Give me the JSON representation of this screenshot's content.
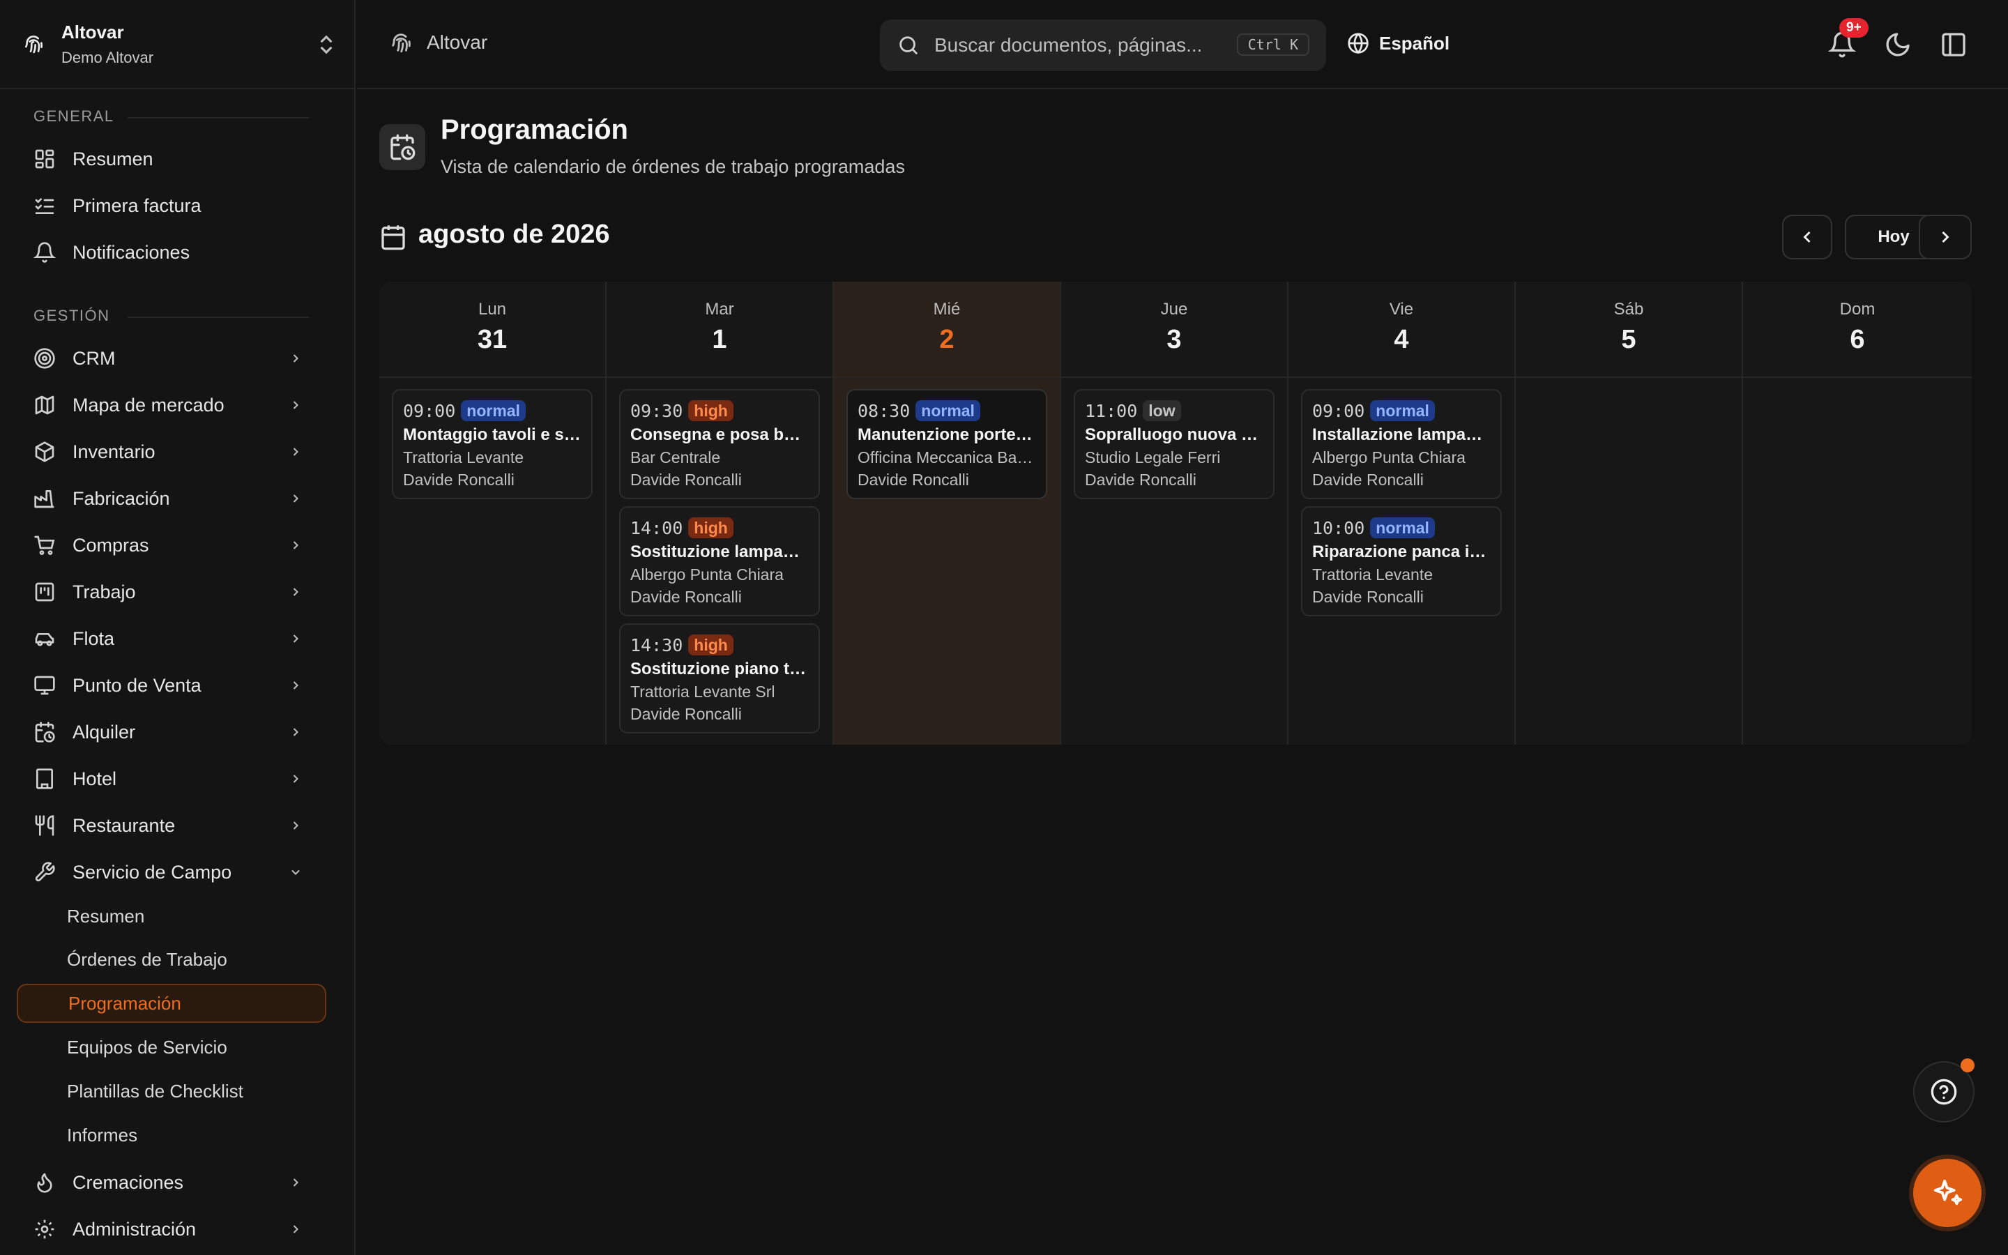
{
  "team": {
    "name": "Altovar",
    "subtitle": "Demo Altovar"
  },
  "sidebar": {
    "group_general": "GENERAL",
    "group_gestion": "GESTIÓN",
    "general": [
      {
        "label": "Resumen",
        "icon": "dashboard-icon"
      },
      {
        "label": "Primera factura",
        "icon": "checklist-icon"
      },
      {
        "label": "Notificaciones",
        "icon": "bell-icon"
      }
    ],
    "gestion": [
      {
        "label": "CRM",
        "icon": "target-icon"
      },
      {
        "label": "Mapa de mercado",
        "icon": "map-icon"
      },
      {
        "label": "Inventario",
        "icon": "box-icon"
      },
      {
        "label": "Fabricación",
        "icon": "factory-icon"
      },
      {
        "label": "Compras",
        "icon": "cart-icon"
      },
      {
        "label": "Trabajo",
        "icon": "kanban-icon"
      },
      {
        "label": "Flota",
        "icon": "car-icon"
      },
      {
        "label": "Punto de Venta",
        "icon": "monitor-icon"
      },
      {
        "label": "Alquiler",
        "icon": "calendar-clock-icon"
      },
      {
        "label": "Hotel",
        "icon": "building-icon"
      },
      {
        "label": "Restaurante",
        "icon": "utensils-icon"
      },
      {
        "label": "Servicio de Campo",
        "icon": "wrench-icon"
      }
    ],
    "field_service_sub": [
      {
        "label": "Resumen"
      },
      {
        "label": "Órdenes de Trabajo"
      },
      {
        "label": "Programación",
        "active": true
      },
      {
        "label": "Equipos de Servicio"
      },
      {
        "label": "Plantillas de Checklist"
      },
      {
        "label": "Informes"
      }
    ],
    "bottom": [
      {
        "label": "Cremaciones",
        "icon": "flame-icon"
      },
      {
        "label": "Administración",
        "icon": "gear-icon"
      }
    ]
  },
  "topbar": {
    "breadcrumb": "Altovar",
    "search_placeholder": "Buscar documentos, páginas...",
    "shortcut": "Ctrl K",
    "language": "Español",
    "notification_count": "9+"
  },
  "page": {
    "title": "Programación",
    "subtitle": "Vista de calendario de órdenes de trabajo programadas",
    "month_label": "agosto de 2026",
    "today_button": "Hoy"
  },
  "calendar": {
    "days": [
      {
        "dow": "Lun",
        "num": "31",
        "events": [
          {
            "time": "09:00",
            "priority": "normal",
            "title": "Montaggio tavoli e sedie",
            "client": "Trattoria Levante",
            "tech": "Davide Roncalli"
          }
        ]
      },
      {
        "dow": "Mar",
        "num": "1",
        "events": [
          {
            "time": "09:30",
            "priority": "high",
            "title": "Consegna e posa banco",
            "client": "Bar Centrale",
            "tech": "Davide Roncalli"
          },
          {
            "time": "14:00",
            "priority": "high",
            "title": "Sostituzione lampade sala",
            "client": "Albergo Punta Chiara",
            "tech": "Davide Roncalli"
          },
          {
            "time": "14:30",
            "priority": "high",
            "title": "Sostituzione piano tavolo",
            "client": "Trattoria Levante Srl",
            "tech": "Davide Roncalli"
          }
        ]
      },
      {
        "dow": "Mié",
        "num": "2",
        "today": true,
        "events": [
          {
            "time": "08:30",
            "priority": "normal",
            "title": "Manutenzione porte sezionali",
            "client": "Officina Meccanica Baldini",
            "tech": "Davide Roncalli"
          }
        ]
      },
      {
        "dow": "Jue",
        "num": "3",
        "events": [
          {
            "time": "11:00",
            "priority": "low",
            "title": "Sopralluogo nuova sala riunioni",
            "client": "Studio Legale Ferri",
            "tech": "Davide Roncalli"
          }
        ]
      },
      {
        "dow": "Vie",
        "num": "4",
        "events": [
          {
            "time": "09:00",
            "priority": "normal",
            "title": "Installazione lampade esterne",
            "client": "Albergo Punta Chiara",
            "tech": "Davide Roncalli"
          },
          {
            "time": "10:00",
            "priority": "normal",
            "title": "Riparazione panca imbottita",
            "client": "Trattoria Levante",
            "tech": "Davide Roncalli"
          }
        ]
      },
      {
        "dow": "Sáb",
        "num": "5",
        "events": []
      },
      {
        "dow": "Dom",
        "num": "6",
        "events": []
      }
    ]
  },
  "colors": {
    "accent": "#f06d20",
    "background": "#121212",
    "normal": "#1e3a8a",
    "high": "#7a2a10"
  }
}
